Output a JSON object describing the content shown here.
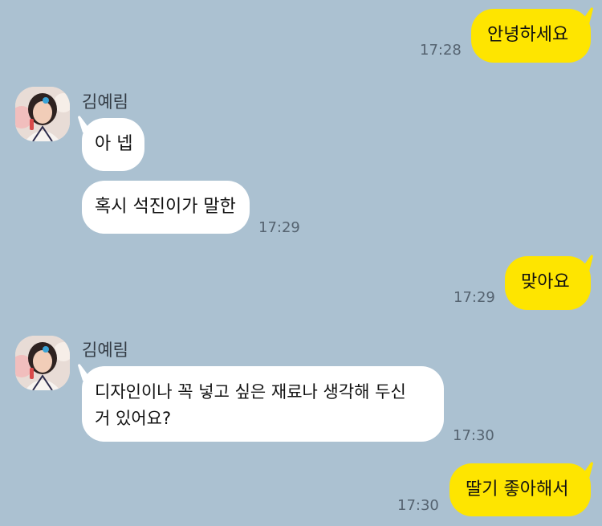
{
  "chat": {
    "messages": [
      {
        "sender": "me",
        "text": "안녕하세요",
        "time": "17:28"
      },
      {
        "sender": "김예림",
        "name": "김예림",
        "texts": [
          "아 넵",
          "혹시 석진이가 말한"
        ],
        "time": "17:29"
      },
      {
        "sender": "me",
        "text": "맞아요",
        "time": "17:29"
      },
      {
        "sender": "김예림",
        "name": "김예림",
        "line1": "디자인이나 꼭 넣고 싶은 재료나 생각해 두신",
        "line2": "거 있어요?",
        "time": "17:30"
      },
      {
        "sender": "me",
        "text": "딸기 좋아해서",
        "time": "17:30"
      }
    ]
  },
  "colors": {
    "background": "#abc1d1",
    "my_bubble": "#fee500",
    "their_bubble": "#ffffff"
  }
}
